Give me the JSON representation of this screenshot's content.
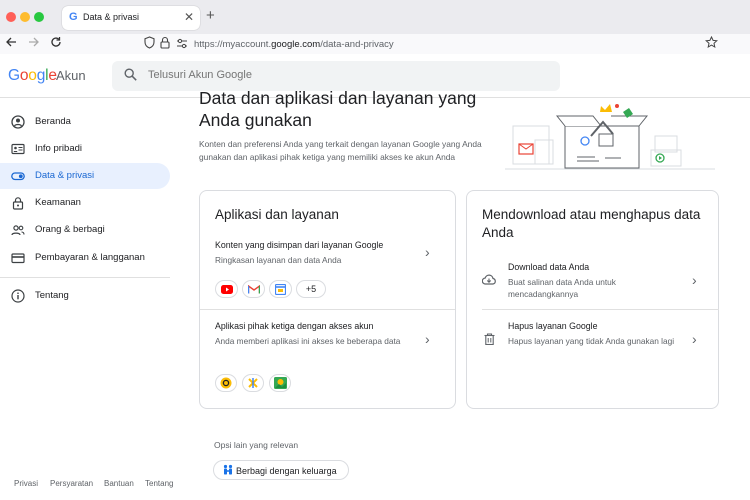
{
  "browser": {
    "tab_title": "Data & privasi",
    "tab_favicon": "G",
    "close_glyph": "✕",
    "newtab_glyph": "+",
    "url_prefix": "https://myaccount.",
    "url_domain": "google.com",
    "url_path": "/data-and-privacy",
    "icons": [
      "back-icon",
      "forward-icon",
      "reload-icon",
      "shield-icon",
      "lock-icon",
      "permissions-icon",
      "bookmark-star-icon"
    ]
  },
  "header": {
    "logo": [
      "G",
      "o",
      "o",
      "g",
      "l",
      "e"
    ],
    "product": "Akun",
    "search_placeholder": "Telusuri Akun Google"
  },
  "sidebar": {
    "items": [
      {
        "label": "Beranda",
        "icon": "home-icon"
      },
      {
        "label": "Info pribadi",
        "icon": "id-card-icon"
      },
      {
        "label": "Data & privasi",
        "icon": "toggle-icon"
      },
      {
        "label": "Keamanan",
        "icon": "lock-icon"
      },
      {
        "label": "Orang & berbagi",
        "icon": "people-icon"
      },
      {
        "label": "Pembayaran & langganan",
        "icon": "card-icon"
      },
      {
        "label": "Tentang",
        "icon": "info-icon"
      }
    ],
    "footer": [
      "Privasi",
      "Persyaratan",
      "Bantuan",
      "Tentang"
    ]
  },
  "main": {
    "title": "Data dan aplikasi dan layanan yang Anda gunakan",
    "description": "Konten dan preferensi Anda yang terkait dengan layanan Google yang Anda gunakan dan aplikasi pihak ketiga yang memiliki akses ke akun Anda",
    "card_apps": {
      "title": "Aplikasi dan layanan",
      "rows": [
        {
          "title": "Konten yang disimpan dari layanan Google",
          "subtitle": "Ringkasan layanan dan data Anda"
        },
        {
          "title": "Aplikasi pihak ketiga dengan akses akun",
          "subtitle": "Anda memberi aplikasi ini akses ke beberapa data"
        }
      ],
      "more_chip": "+5"
    },
    "card_download": {
      "title": "Mendownload atau menghapus data Anda",
      "rows": [
        {
          "title": "Download data Anda",
          "subtitle": "Buat salinan data Anda untuk mencadangkannya"
        },
        {
          "title": "Hapus layanan Google",
          "subtitle": "Hapus layanan yang tidak Anda gunakan lagi"
        }
      ]
    },
    "related_label": "Opsi lain yang relevan",
    "family_button": "Berbagi dengan keluarga"
  },
  "colors": {
    "accent": "#1a73e8",
    "active_bg": "#e8f0fe"
  }
}
